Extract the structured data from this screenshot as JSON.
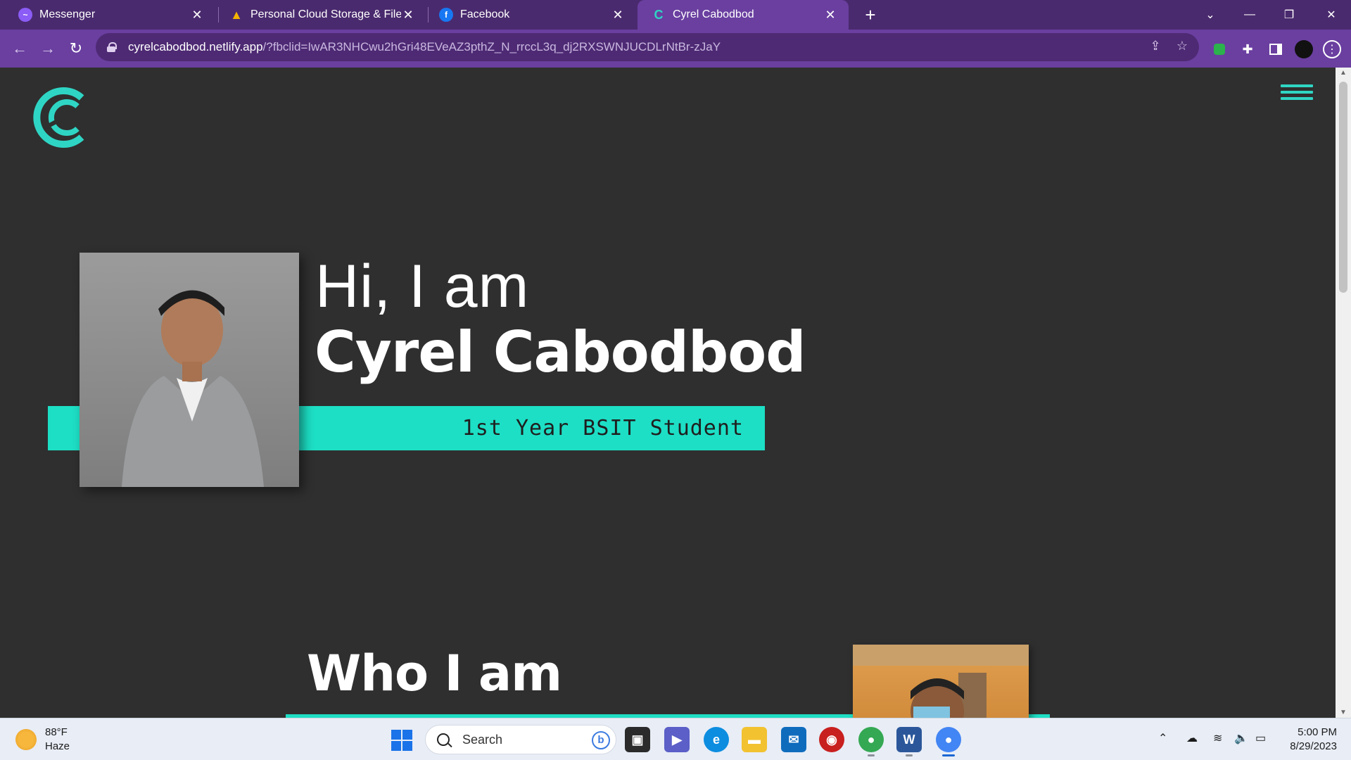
{
  "browser": {
    "tabs": [
      {
        "title": "Messenger",
        "icon": "messenger-icon",
        "color": "#8b5cf6"
      },
      {
        "title": "Personal Cloud Storage & File Sh",
        "icon": "google-drive-icon",
        "color": "#f4b400"
      },
      {
        "title": "Facebook",
        "icon": "facebook-icon",
        "color": "#1877f2"
      },
      {
        "title": "Cyrel Cabodbod",
        "icon": "site-logo-icon",
        "color": "#2fd5c4"
      }
    ],
    "close_glyph": "✕",
    "new_tab_glyph": "+",
    "url_host": "cyrelcabodbod.netlify.app",
    "url_rest": "/?fbclid=IwAR3NHCwu2hGri48EVeAZ3pthZ_N_rrccL3q_dj2RXSWNJUCDLrNtBr-zJaY"
  },
  "site": {
    "greeting": "Hi, I am",
    "name": "Cyrel Cabodbod",
    "role": "1st Year BSIT Student",
    "section_title": "Who I am",
    "accent_color": "#1ddfc5"
  },
  "taskbar": {
    "weather_temp": "88°F",
    "weather_desc": "Haze",
    "search_placeholder": "Search",
    "time": "5:00 PM",
    "date": "8/29/2023"
  }
}
